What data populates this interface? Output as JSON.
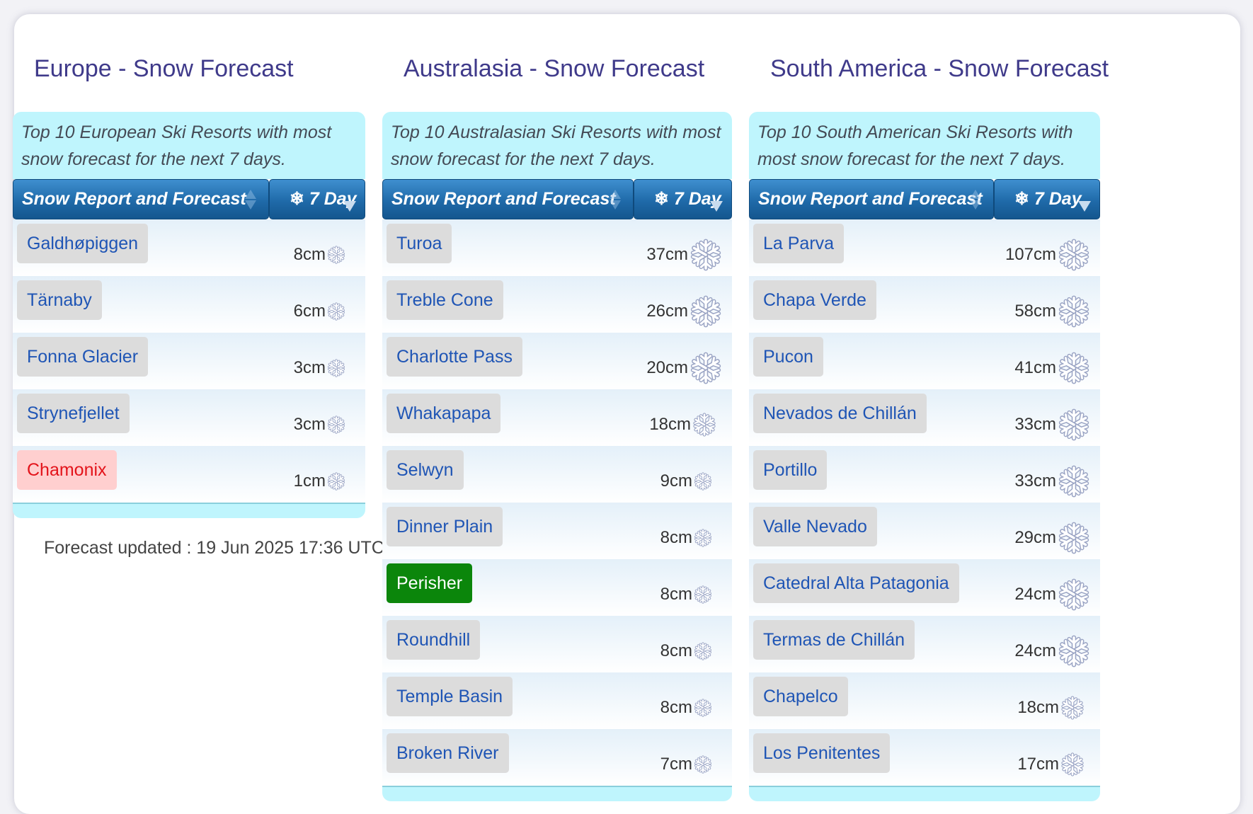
{
  "regions": [
    {
      "title": "Europe - Snow Forecast",
      "intro": "Top 10 European Ski Resorts with most snow forecast for the next 7 days.",
      "col_header": "Snow Report and Forecast",
      "day_header": "7 Day",
      "rows": [
        {
          "name": "Galdhøpiggen",
          "amount": "8cm",
          "style": "normal"
        },
        {
          "name": "Tärnaby",
          "amount": "6cm",
          "style": "normal"
        },
        {
          "name": "Fonna Glacier",
          "amount": "3cm",
          "style": "normal"
        },
        {
          "name": "Strynefjellet",
          "amount": "3cm",
          "style": "normal"
        },
        {
          "name": "Chamonix",
          "amount": "1cm",
          "style": "hot"
        }
      ]
    },
    {
      "title": "Australasia - Snow Forecast",
      "intro": "Top 10 Australasian Ski Resorts with most snow forecast for the next 7 days.",
      "col_header": "Snow Report and Forecast",
      "day_header": "7 Day",
      "rows": [
        {
          "name": "Turoa",
          "amount": "37cm",
          "style": "normal"
        },
        {
          "name": "Treble Cone",
          "amount": "26cm",
          "style": "normal"
        },
        {
          "name": "Charlotte Pass",
          "amount": "20cm",
          "style": "normal"
        },
        {
          "name": "Whakapapa",
          "amount": "18cm",
          "style": "normal"
        },
        {
          "name": "Selwyn",
          "amount": "9cm",
          "style": "normal"
        },
        {
          "name": "Dinner Plain",
          "amount": "8cm",
          "style": "normal"
        },
        {
          "name": "Perisher",
          "amount": "8cm",
          "style": "green"
        },
        {
          "name": "Roundhill",
          "amount": "8cm",
          "style": "normal"
        },
        {
          "name": "Temple Basin",
          "amount": "8cm",
          "style": "normal"
        },
        {
          "name": "Broken River",
          "amount": "7cm",
          "style": "normal"
        }
      ]
    },
    {
      "title": "South America - Snow Forecast",
      "intro": "Top 10 South American Ski Resorts with most snow forecast for the next 7 days.",
      "col_header": "Snow Report and Forecast",
      "day_header": "7 Day",
      "rows": [
        {
          "name": "La Parva",
          "amount": "107cm",
          "style": "normal"
        },
        {
          "name": "Chapa Verde",
          "amount": "58cm",
          "style": "normal"
        },
        {
          "name": "Pucon",
          "amount": "41cm",
          "style": "normal"
        },
        {
          "name": "Nevados de Chillán",
          "amount": "33cm",
          "style": "normal"
        },
        {
          "name": "Portillo",
          "amount": "33cm",
          "style": "normal"
        },
        {
          "name": "Valle Nevado",
          "amount": "29cm",
          "style": "normal"
        },
        {
          "name": "Catedral Alta Patagonia",
          "amount": "24cm",
          "style": "normal"
        },
        {
          "name": "Termas de Chillán",
          "amount": "24cm",
          "style": "normal"
        },
        {
          "name": "Chapelco",
          "amount": "18cm",
          "style": "normal"
        },
        {
          "name": "Los Penitentes",
          "amount": "17cm",
          "style": "normal"
        }
      ]
    }
  ],
  "forecast_updated": "Forecast updated : 19 Jun 2025 17:36 UTC",
  "colors": {
    "title": "#3f3a8a",
    "link": "#1f55b5",
    "header": "#1f6aa9",
    "band": "#bff5fd",
    "hot": "#e3141b",
    "green": "#0b860b"
  },
  "icons": {
    "snowflake": "snowflake-icon",
    "sort": "sort-arrows-icon"
  }
}
